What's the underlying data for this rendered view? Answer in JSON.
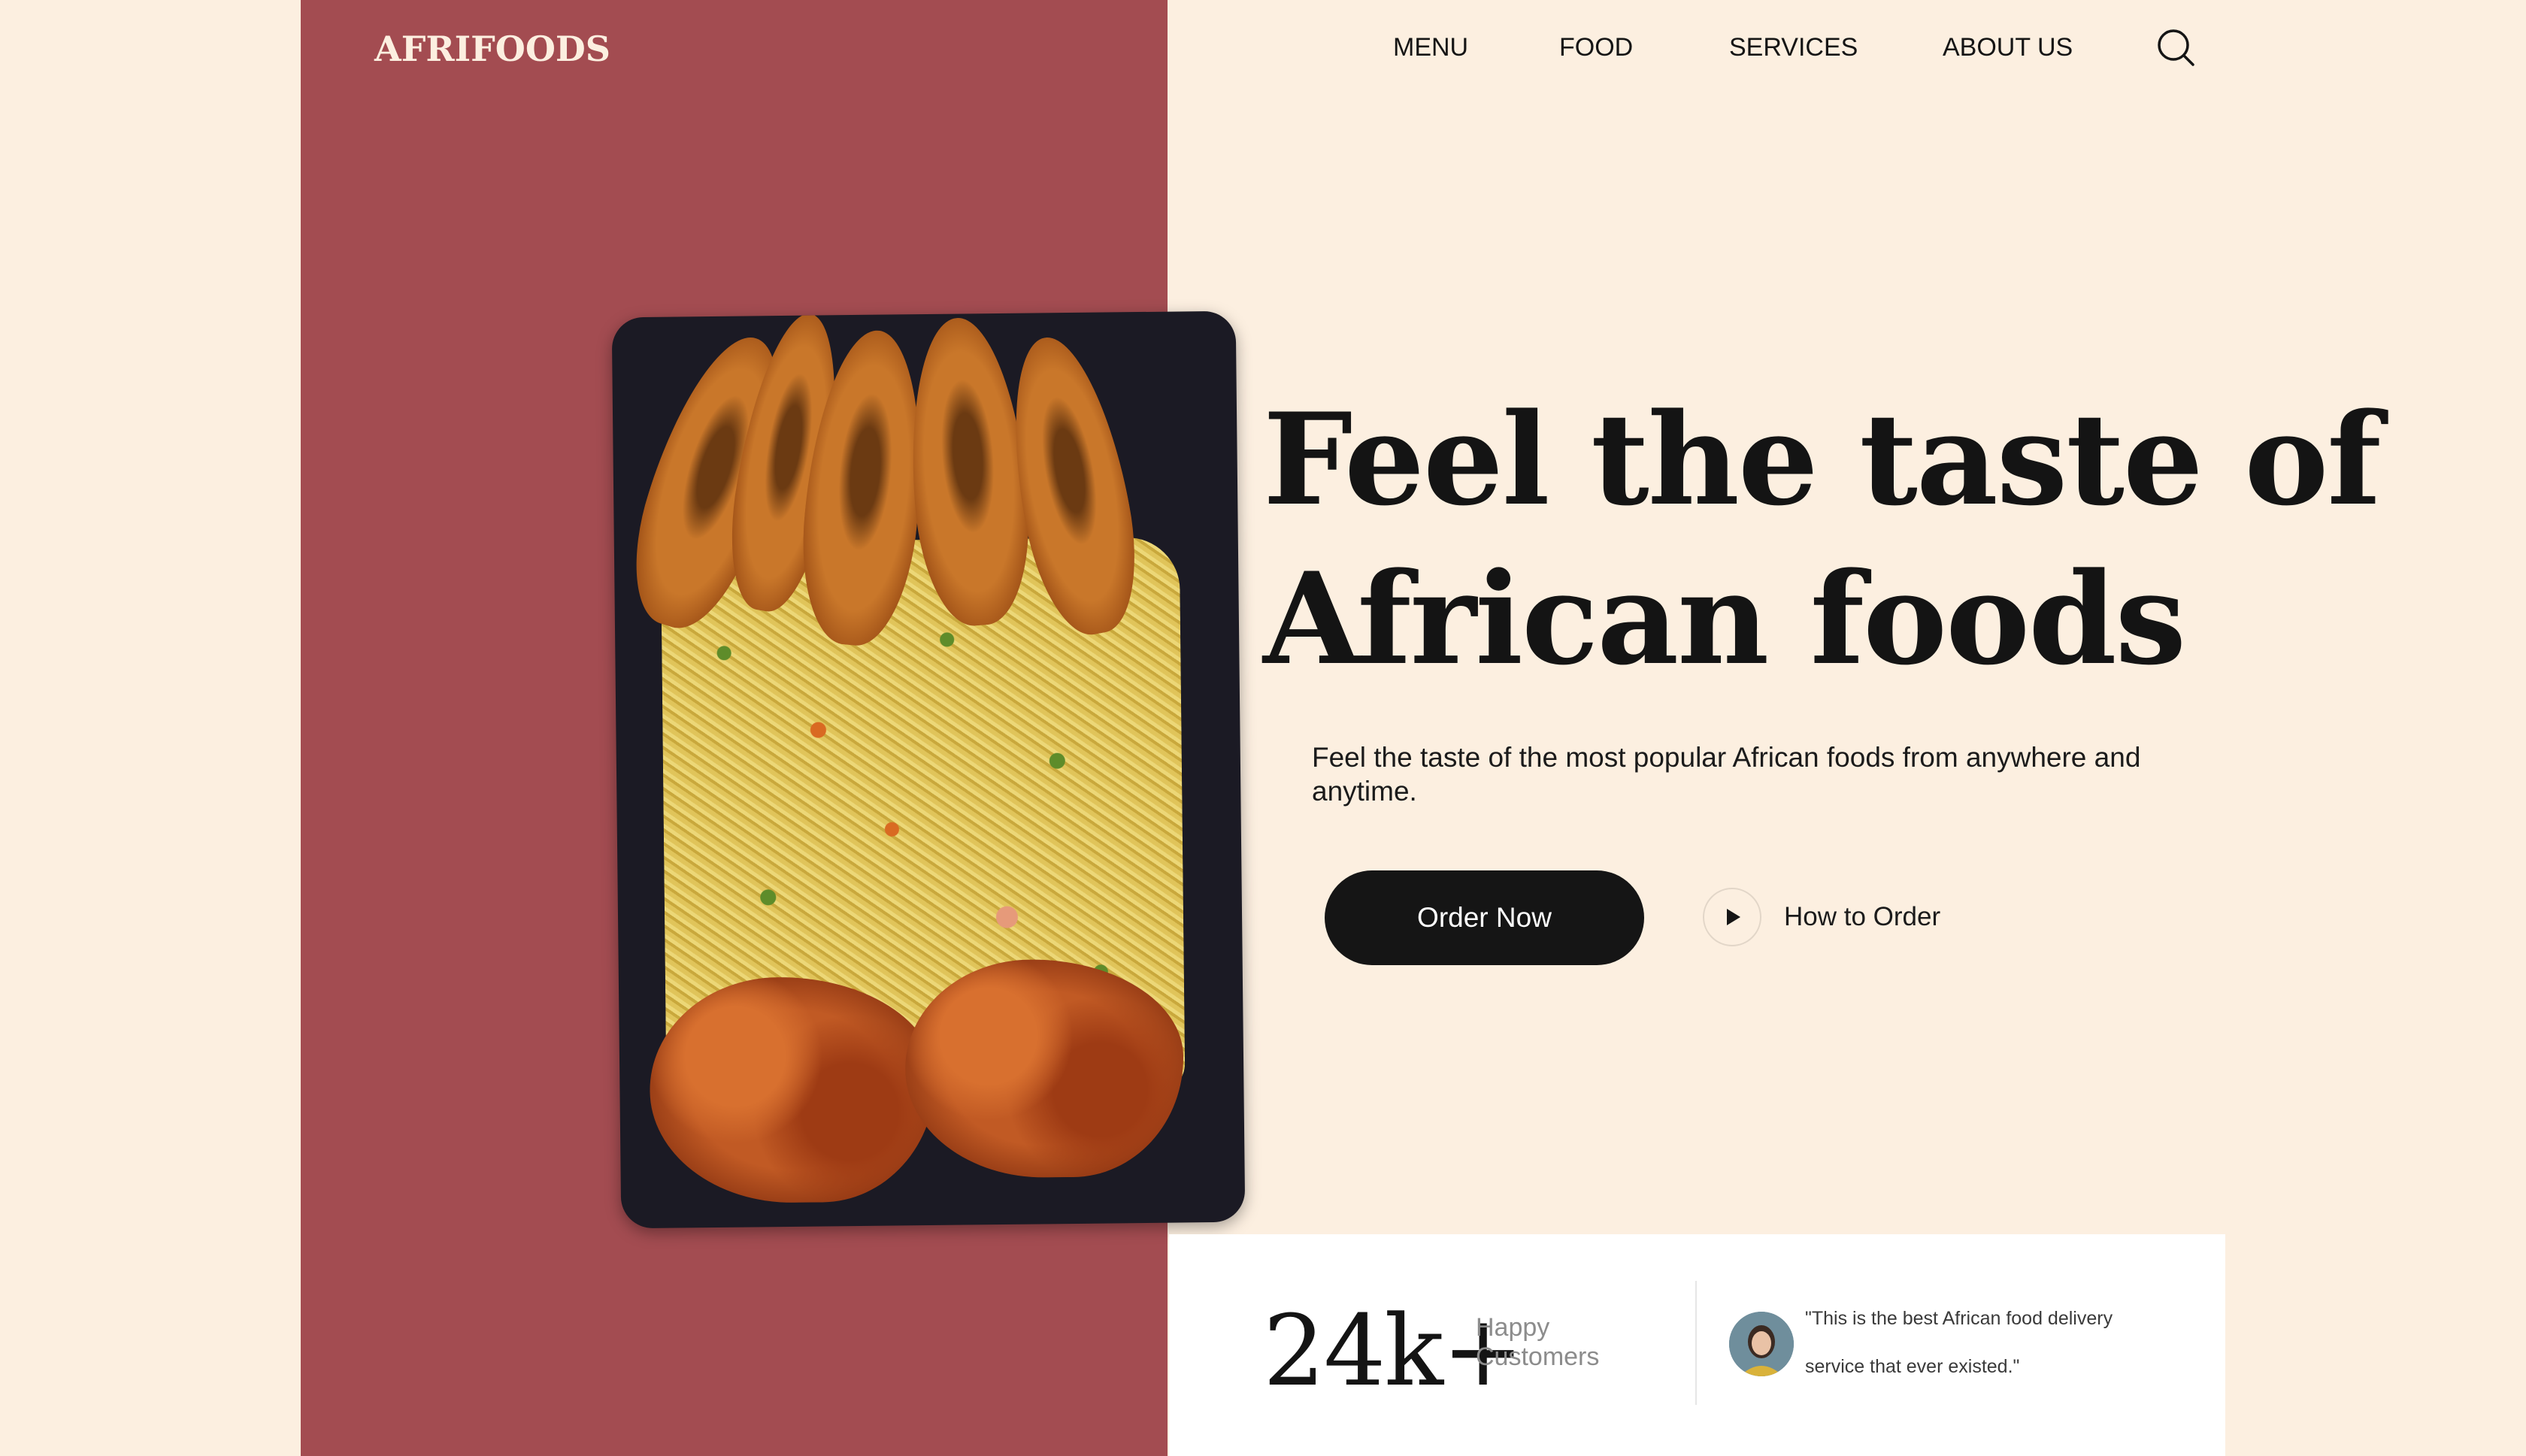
{
  "brand": {
    "logo": "AFRIFOODS"
  },
  "nav": {
    "items": [
      {
        "label": "MENU"
      },
      {
        "label": "FOOD"
      },
      {
        "label": "SERVICES"
      },
      {
        "label": "ABOUT US"
      }
    ],
    "search_icon": "search-icon"
  },
  "hero": {
    "headline_line1": "Feel the taste of",
    "headline_line2": "African foods",
    "subtext": "Feel the taste of the most popular African foods from anywhere and anytime.",
    "order_button": "Order Now",
    "how_to_order": "How to Order",
    "play_icon": "play-icon"
  },
  "stats": {
    "count": "24k+",
    "label_line1": "Happy",
    "label_line2": "Customers",
    "testimonial": "\"This is the best African food delivery service that ever existed.\""
  },
  "colors": {
    "background": "#fcefe0",
    "panel": "#a34c51",
    "text_dark": "#141414",
    "button": "#151515"
  }
}
